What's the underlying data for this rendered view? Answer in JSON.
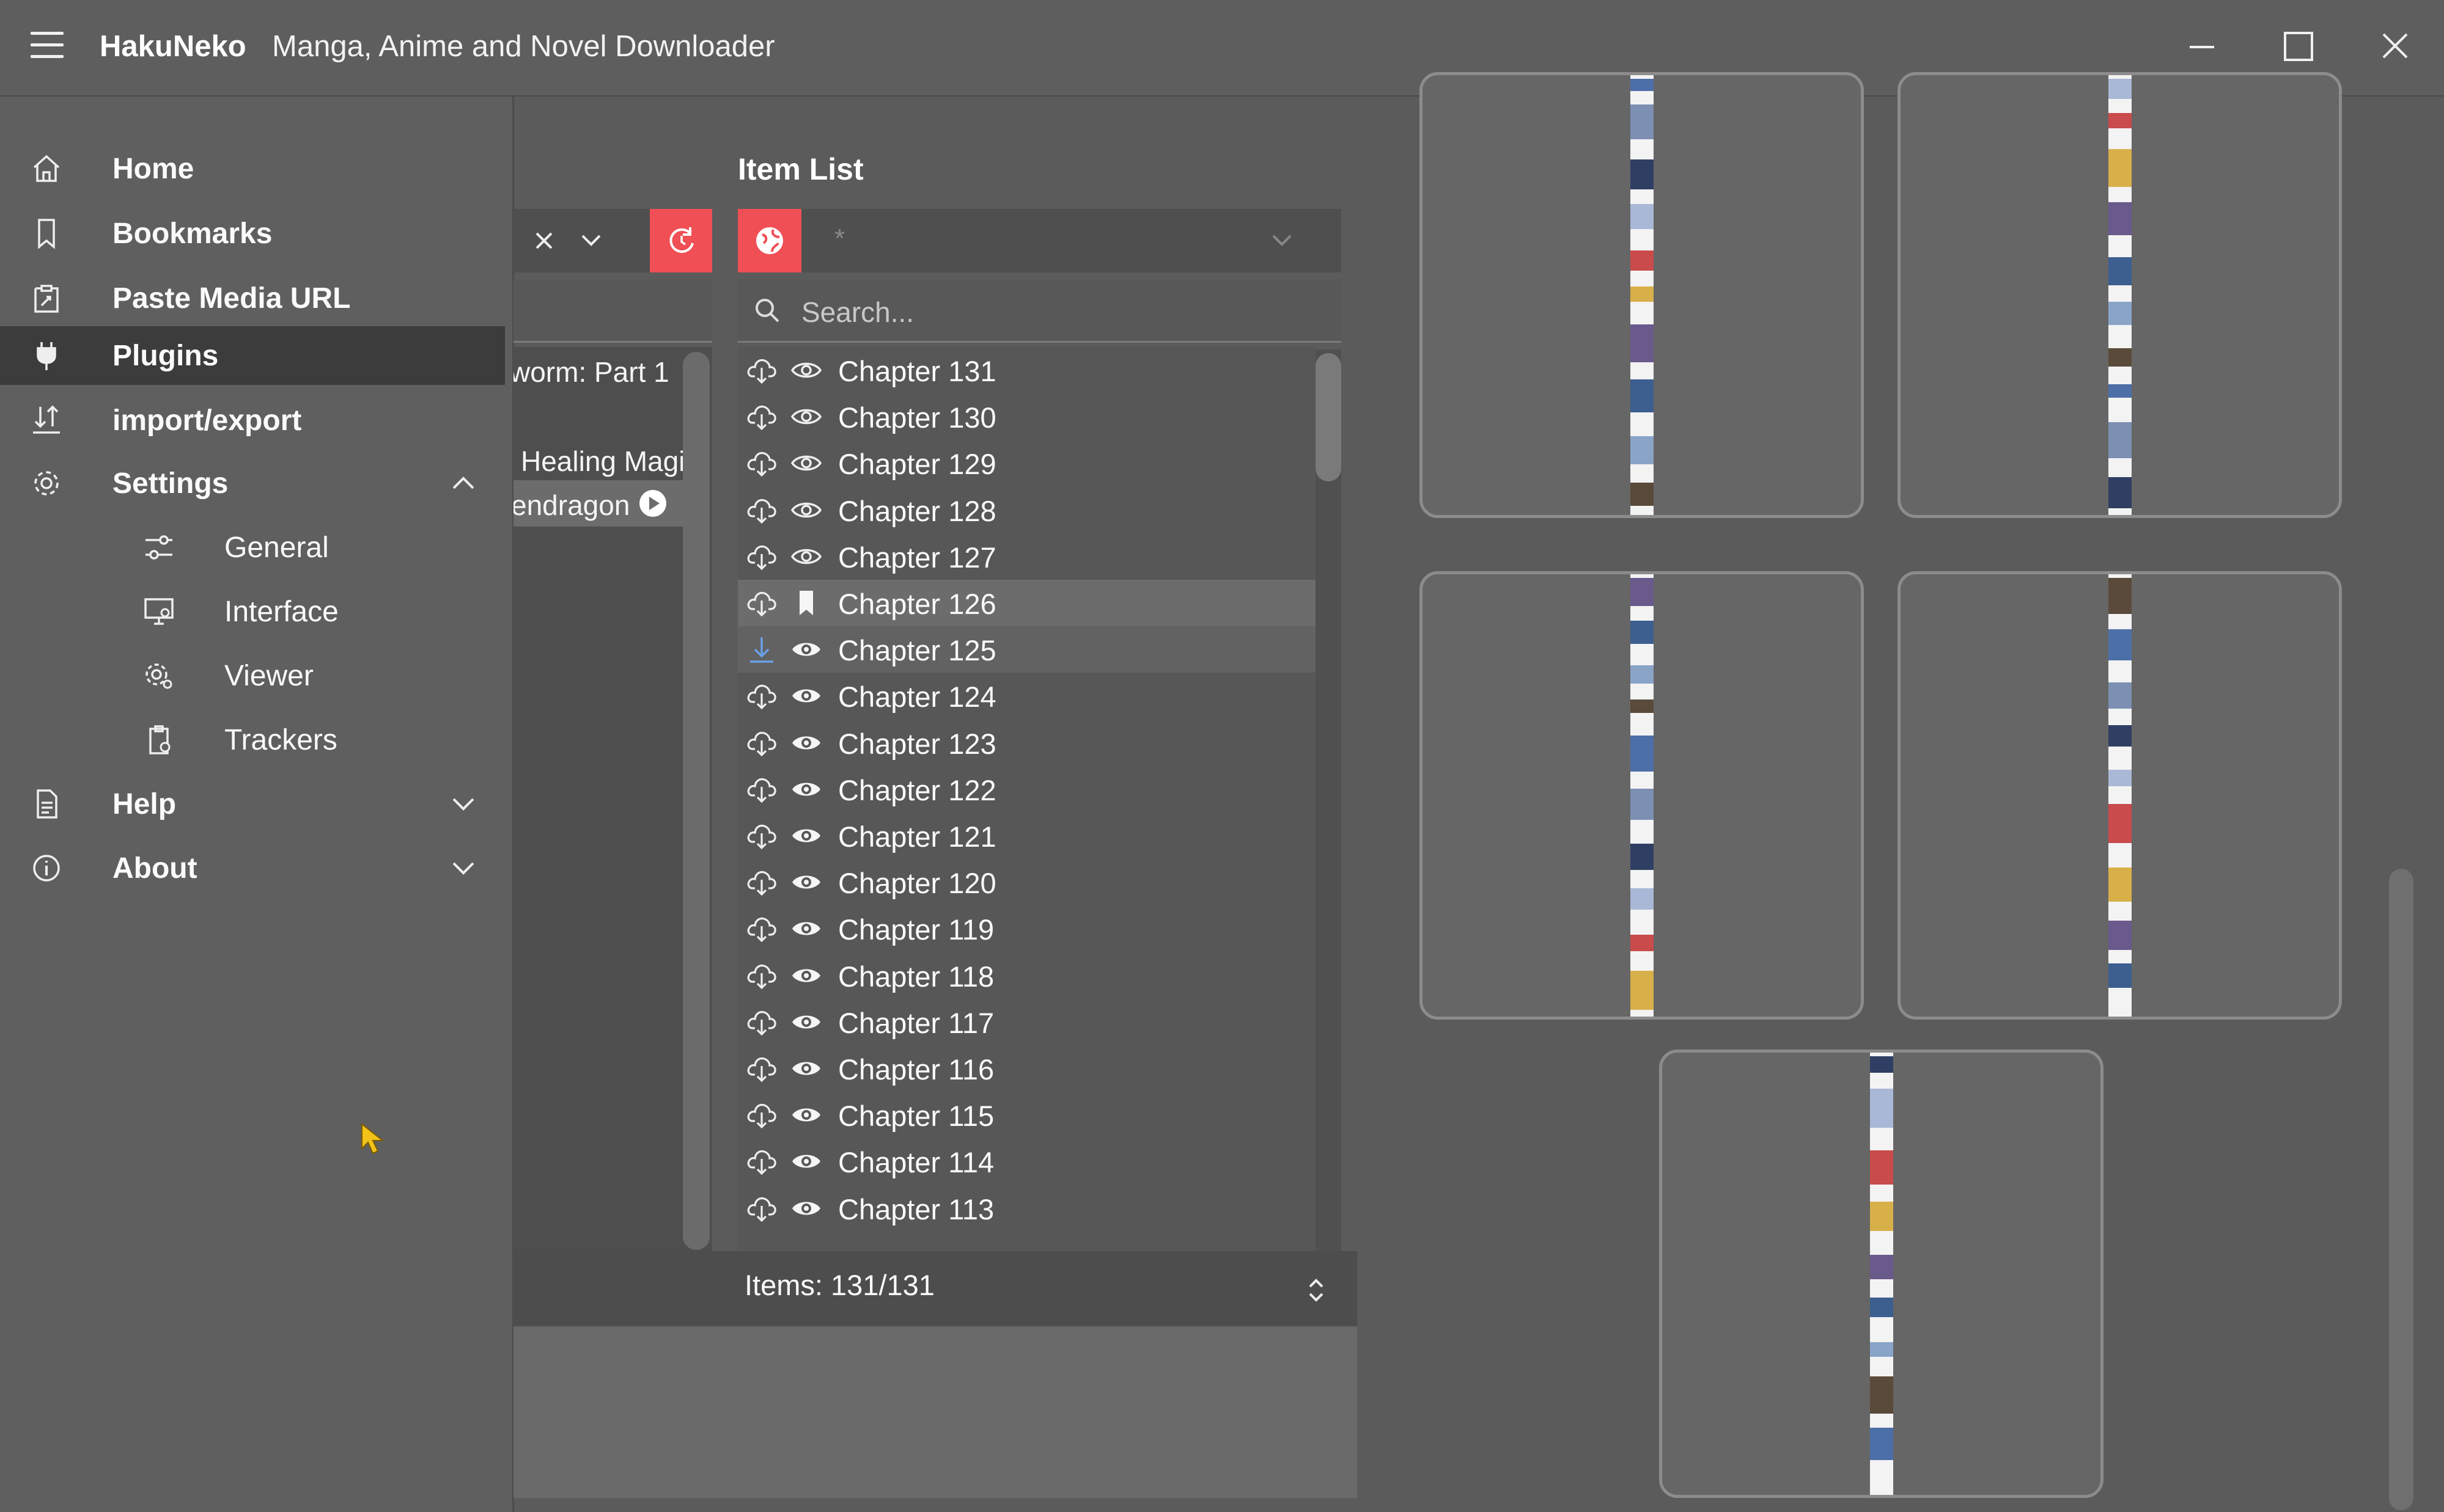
{
  "titlebar": {
    "app_name": "HakuNeko",
    "subtitle": "Manga, Anime and Novel Downloader"
  },
  "sidebar": {
    "items": [
      {
        "label": "Home",
        "icon": "home-icon"
      },
      {
        "label": "Bookmarks",
        "icon": "bookmark-icon"
      },
      {
        "label": "Paste Media URL",
        "icon": "paste-icon"
      },
      {
        "label": "Plugins",
        "icon": "plug-icon",
        "active": true
      },
      {
        "label": "import/export",
        "icon": "import-export-icon"
      },
      {
        "label": "Settings",
        "icon": "gear-icon",
        "expanded": true
      },
      {
        "label": "General",
        "icon": "sliders-icon"
      },
      {
        "label": "Interface",
        "icon": "monitor-icon"
      },
      {
        "label": "Viewer",
        "icon": "viewer-gear-icon"
      },
      {
        "label": "Trackers",
        "icon": "clipboard-gear-icon"
      },
      {
        "label": "Help",
        "icon": "document-icon",
        "expanded": false
      },
      {
        "label": "About",
        "icon": "info-icon",
        "expanded": false
      }
    ]
  },
  "plugins": {
    "rows": [
      "worm: Part 1",
      "Healing Magi",
      "endragon"
    ]
  },
  "item_list": {
    "title": "Item List",
    "language_value": "*",
    "search_placeholder": "Search...",
    "count_label": "Items: 131/131",
    "chapters": [
      {
        "label": "Chapter 131",
        "status": "eye-outline"
      },
      {
        "label": "Chapter 130",
        "status": "eye-outline"
      },
      {
        "label": "Chapter 129",
        "status": "eye-outline"
      },
      {
        "label": "Chapter 128",
        "status": "eye-outline"
      },
      {
        "label": "Chapter 127",
        "status": "eye-outline"
      },
      {
        "label": "Chapter 126",
        "status": "bookmark"
      },
      {
        "label": "Chapter 125",
        "status": "eye-filled",
        "downloaded": true
      },
      {
        "label": "Chapter 124",
        "status": "eye-filled"
      },
      {
        "label": "Chapter 123",
        "status": "eye-filled"
      },
      {
        "label": "Chapter 122",
        "status": "eye-filled"
      },
      {
        "label": "Chapter 121",
        "status": "eye-filled"
      },
      {
        "label": "Chapter 120",
        "status": "eye-filled"
      },
      {
        "label": "Chapter 119",
        "status": "eye-filled"
      },
      {
        "label": "Chapter 118",
        "status": "eye-filled"
      },
      {
        "label": "Chapter 117",
        "status": "eye-filled"
      },
      {
        "label": "Chapter 116",
        "status": "eye-filled"
      },
      {
        "label": "Chapter 115",
        "status": "eye-filled"
      },
      {
        "label": "Chapter 114",
        "status": "eye-filled"
      },
      {
        "label": "Chapter 113",
        "status": "eye-filled"
      }
    ]
  },
  "colors": {
    "accent": "#ef4f55",
    "active_nav": "#3c3c3c",
    "cursor": "#f2c21b",
    "download_done": "#6aa0e6"
  }
}
